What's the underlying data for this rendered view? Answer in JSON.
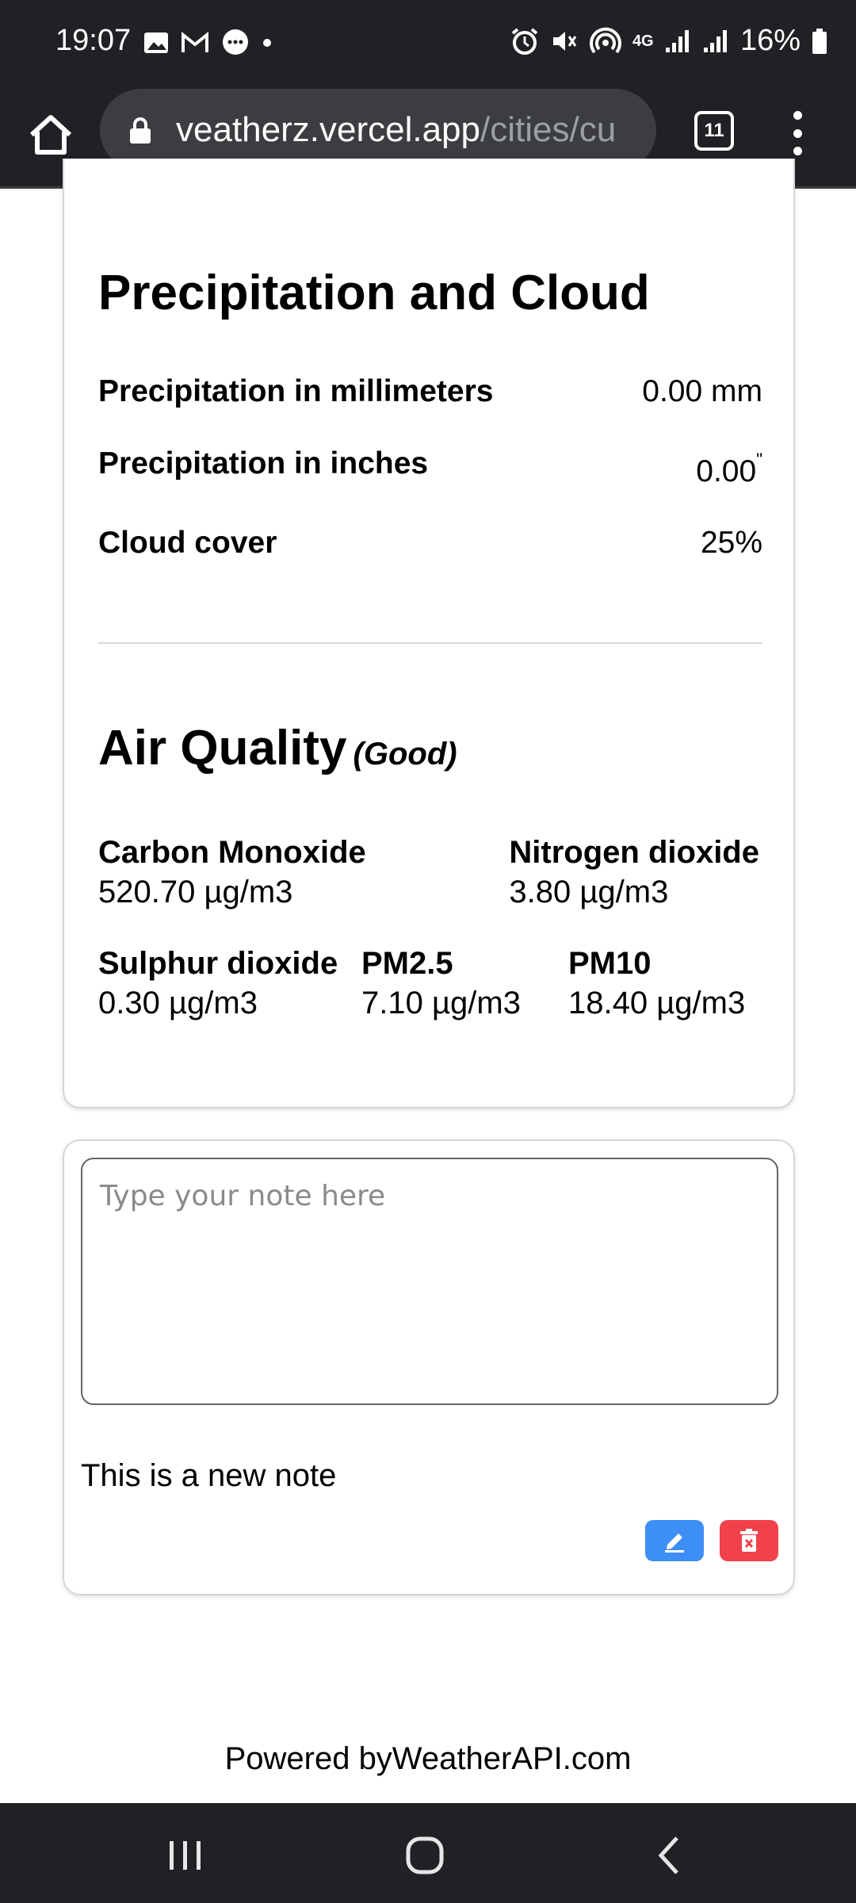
{
  "status_bar": {
    "time": "19:07",
    "battery": "16%",
    "network": "4G"
  },
  "browser": {
    "url_host": "veatherz.vercel.app",
    "url_path": "/cities/cu",
    "tab_count": "11"
  },
  "precipitation": {
    "title": "Precipitation and Cloud",
    "rows": [
      {
        "label": "Precipitation in millimeters",
        "value": "0.00 mm"
      },
      {
        "label": "Precipitation in inches",
        "value": "0.00",
        "unit": "\""
      },
      {
        "label": "Cloud cover",
        "value": "25%"
      }
    ]
  },
  "air_quality": {
    "title": "Air Quality",
    "status": "(Good)",
    "items": [
      {
        "name": "Carbon Monoxide",
        "value": "520.70 µg/m3"
      },
      {
        "name": "Nitrogen dioxide",
        "value": "3.80 µg/m3"
      },
      {
        "name": "Sulphur dioxide",
        "value": "0.30 µg/m3"
      },
      {
        "name": "PM2.5",
        "value": "7.10 µg/m3"
      },
      {
        "name": "PM10",
        "value": "18.40 µg/m3"
      }
    ]
  },
  "notes": {
    "placeholder": "Type your note here",
    "items": [
      {
        "text": "This is a new note"
      }
    ]
  },
  "footer": {
    "text": "Powered byWeatherAPI.com"
  },
  "colors": {
    "edit": "#3e8ef7",
    "delete": "#f0414d",
    "chrome": "#202124"
  }
}
